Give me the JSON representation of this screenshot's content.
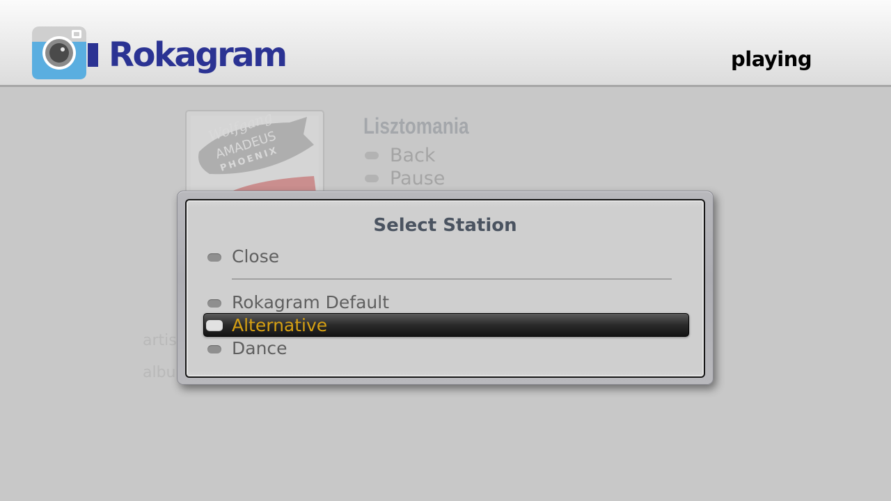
{
  "header": {
    "app_name": "Rokagram",
    "status": "playing",
    "logo_icon": "camera-icon",
    "brand_color": "#2b3393"
  },
  "now_playing": {
    "track_title": "Lisztomania",
    "album_art_text": [
      "Wolfgang",
      "AMADEUS",
      "PHOENIX"
    ],
    "options": [
      {
        "label": "Back"
      },
      {
        "label": "Pause"
      }
    ],
    "meta_labels": [
      "artis",
      "albu"
    ]
  },
  "dialog": {
    "title": "Select Station",
    "close_label": "Close",
    "stations": [
      {
        "label": "Rokagram Default",
        "selected": false
      },
      {
        "label": "Alternative",
        "selected": true
      },
      {
        "label": "Dance",
        "selected": false
      }
    ],
    "selected_color": "#d6a013"
  }
}
